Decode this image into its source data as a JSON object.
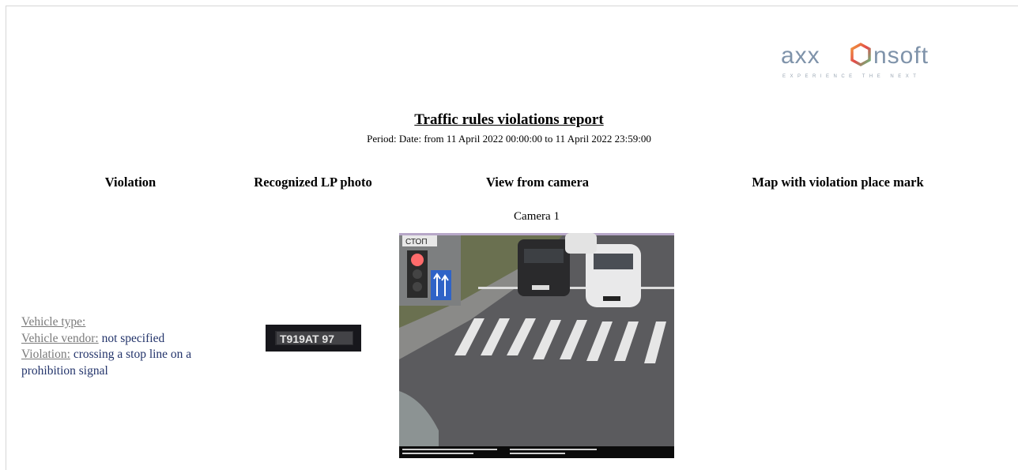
{
  "logo": {
    "text_left": "axx",
    "text_right": "nsoft",
    "tagline": "EXPERIENCE THE NEXT"
  },
  "report": {
    "title": "Traffic rules violations report",
    "period": "Period: Date: from 11 April 2022 00:00:00 to 11 April 2022 23:59:00"
  },
  "columns": {
    "violation": "Violation",
    "lp_photo": "Recognized LP photo",
    "camera_view": "View from camera",
    "map": "Map with violation place mark"
  },
  "camera_label": "Camera 1",
  "violation": {
    "vehicle_type_label": "Vehicle type:",
    "vehicle_type_value": "",
    "vehicle_vendor_label": "Vehicle vendor:",
    "vehicle_vendor_value": "not specified",
    "violation_label": "Violation:",
    "violation_value": "crossing a stop line on a prohibition signal"
  },
  "plate_text": "T919AT 97",
  "scene_sign_text": "СТОП",
  "colors": {
    "logo_blue": "#8fa3b8",
    "logo_orange": "#f29a3b",
    "logo_green": "#5fbf7f",
    "link_gray": "#7a7a7a",
    "value_blue": "#23346b"
  }
}
